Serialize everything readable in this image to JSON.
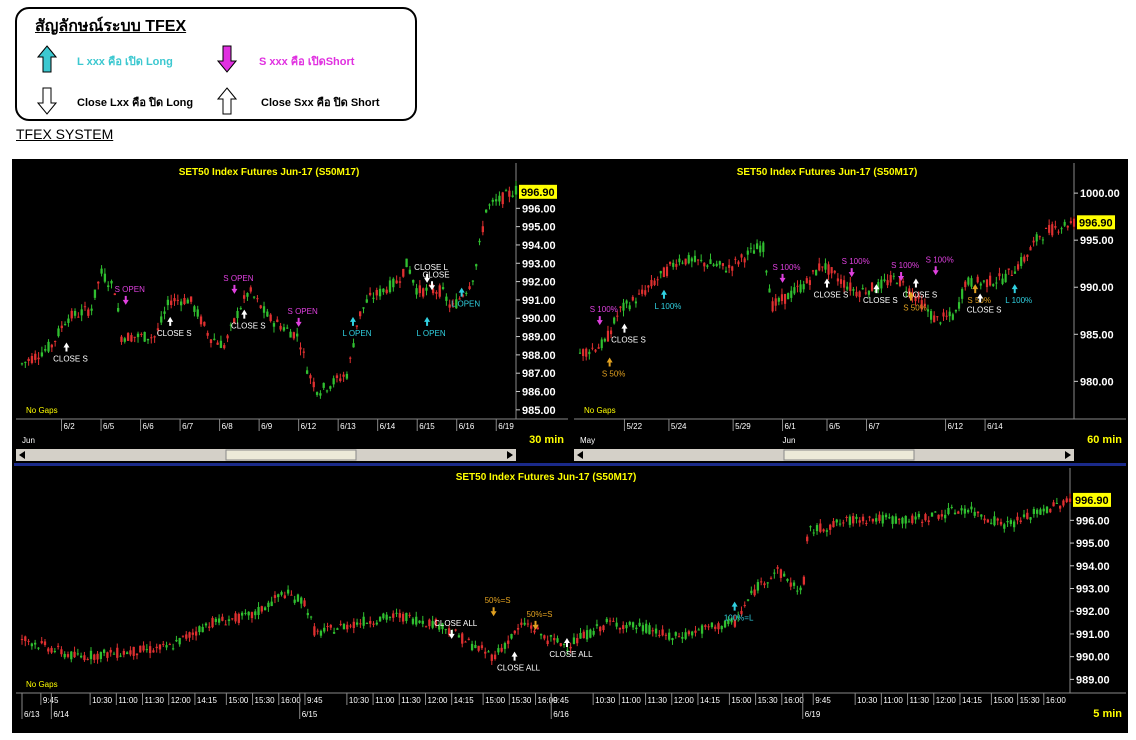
{
  "legend": {
    "title": "สัญลักษณ์ระบบ TFEX",
    "items": [
      {
        "label": "L xxx คือ เปิด Long",
        "color": "#3cc8d0",
        "icon": "arrow-up-cyan-icon"
      },
      {
        "label": "S xxx คือ เปิดShort",
        "color": "#e030e0",
        "icon": "arrow-down-magenta-icon"
      },
      {
        "label": "Close Lxx คือ ปิด Long",
        "color": "#000000",
        "icon": "arrow-down-outline-icon"
      },
      {
        "label": "Close Sxx คือ ปิด Short",
        "color": "#000000",
        "icon": "arrow-up-outline-icon"
      }
    ]
  },
  "section_title": "TFEX SYSTEM",
  "colors": {
    "up": "#30c030",
    "down": "#e03030",
    "title": "#ffff00",
    "long": "#30d0e0",
    "short": "#e040e0",
    "half": "#e0a020",
    "close": "#ffffff",
    "bg": "#000000",
    "axis_text": "#ffffff",
    "price_tag": "#ffff00"
  },
  "chart_data": [
    {
      "type": "candlestick",
      "title": "SET50 Index Futures Jun-17 (S50M17)",
      "interval_label": "30 min",
      "gap_label": "No Gaps",
      "period_label": "Jun",
      "last_price": "996.90",
      "ylim": [
        984.5,
        997.6
      ],
      "yticks": [
        "996.00",
        "995.00",
        "994.00",
        "993.00",
        "992.00",
        "991.00",
        "990.00",
        "989.00",
        "988.00",
        "987.00",
        "986.00",
        "985.00"
      ],
      "ytick_values": [
        996,
        995,
        994,
        993,
        992,
        991,
        990,
        989,
        988,
        987,
        986,
        985
      ],
      "xticks": [
        "6/2",
        "6/5",
        "6/6",
        "6/7",
        "6/8",
        "6/9",
        "6/12",
        "6/13",
        "6/14",
        "6/15",
        "6/16",
        "6/19"
      ],
      "xtick_pos": [
        0.08,
        0.16,
        0.24,
        0.32,
        0.4,
        0.48,
        0.56,
        0.64,
        0.72,
        0.8,
        0.88,
        0.96
      ],
      "anchors": [
        [
          0,
          987.5
        ],
        [
          0.06,
          988.5
        ],
        [
          0.09,
          990
        ],
        [
          0.14,
          990.5
        ],
        [
          0.16,
          992.5
        ],
        [
          0.19,
          991.5
        ],
        [
          0.2,
          989
        ],
        [
          0.27,
          989
        ],
        [
          0.3,
          991
        ],
        [
          0.34,
          991
        ],
        [
          0.38,
          989
        ],
        [
          0.41,
          988.5
        ],
        [
          0.44,
          990.5
        ],
        [
          0.46,
          991.5
        ],
        [
          0.5,
          990
        ],
        [
          0.56,
          989
        ],
        [
          0.58,
          987
        ],
        [
          0.6,
          986
        ],
        [
          0.66,
          987
        ],
        [
          0.68,
          990
        ],
        [
          0.7,
          991
        ],
        [
          0.76,
          992
        ],
        [
          0.78,
          993
        ],
        [
          0.8,
          991.5
        ],
        [
          0.85,
          991.5
        ],
        [
          0.87,
          990.5
        ],
        [
          0.91,
          992
        ],
        [
          0.92,
          993
        ],
        [
          0.94,
          996
        ],
        [
          1.0,
          997
        ]
      ],
      "annotations": [
        {
          "text": "CLOSE S",
          "x": 0.09,
          "y": 988.4,
          "arrow": "up",
          "color": "close"
        },
        {
          "text": "S OPEN",
          "x": 0.21,
          "y": 991.0,
          "arrow": "down",
          "color": "short"
        },
        {
          "text": "CLOSE S",
          "x": 0.3,
          "y": 989.8,
          "arrow": "up",
          "color": "close"
        },
        {
          "text": "S OPEN",
          "x": 0.43,
          "y": 991.6,
          "arrow": "down",
          "color": "short"
        },
        {
          "text": "CLOSE S",
          "x": 0.45,
          "y": 990.2,
          "arrow": "up",
          "color": "close"
        },
        {
          "text": "S OPEN",
          "x": 0.56,
          "y": 989.8,
          "arrow": "down",
          "color": "short"
        },
        {
          "text": "L OPEN",
          "x": 0.67,
          "y": 989.8,
          "arrow": "up",
          "color": "long"
        },
        {
          "text": "CLOSE L",
          "x": 0.82,
          "y": 992.2,
          "arrow": "down",
          "color": "close"
        },
        {
          "text": "CLOSE",
          "x": 0.83,
          "y": 991.8,
          "arrow": "down",
          "color": "close"
        },
        {
          "text": "L OPEN",
          "x": 0.89,
          "y": 991.4,
          "arrow": "up",
          "color": "long"
        },
        {
          "text": "L OPEN",
          "x": 0.82,
          "y": 989.8,
          "arrow": "up",
          "color": "long"
        }
      ]
    },
    {
      "type": "candlestick",
      "title": "SET50 Index Futures Jun-17 (S50M17)",
      "interval_label": "60 min",
      "gap_label": "No Gaps",
      "period_label": "May",
      "period_label2": "Jun",
      "last_price": "996.90",
      "ylim": [
        976,
        1001.5
      ],
      "yticks": [
        "1000.00",
        "995.00",
        "990.00",
        "985.00",
        "980.00"
      ],
      "ytick_values": [
        1000,
        995,
        990,
        985,
        980
      ],
      "xticks": [
        "5/22",
        "5/24",
        "5/29",
        "6/1",
        "6/5",
        "6/7",
        "6/12",
        "6/14"
      ],
      "xtick_pos": [
        0.09,
        0.18,
        0.31,
        0.41,
        0.5,
        0.58,
        0.74,
        0.82
      ],
      "anchors": [
        [
          0,
          983
        ],
        [
          0.05,
          984
        ],
        [
          0.08,
          987.5
        ],
        [
          0.12,
          989
        ],
        [
          0.16,
          991
        ],
        [
          0.2,
          993
        ],
        [
          0.26,
          992.5
        ],
        [
          0.3,
          992
        ],
        [
          0.34,
          993.5
        ],
        [
          0.37,
          994.5
        ],
        [
          0.39,
          988
        ],
        [
          0.42,
          989
        ],
        [
          0.46,
          990.5
        ],
        [
          0.49,
          992.5
        ],
        [
          0.52,
          991
        ],
        [
          0.56,
          989.5
        ],
        [
          0.6,
          990
        ],
        [
          0.64,
          991
        ],
        [
          0.68,
          989
        ],
        [
          0.72,
          986.5
        ],
        [
          0.76,
          987
        ],
        [
          0.78,
          990.5
        ],
        [
          0.82,
          990.5
        ],
        [
          0.86,
          991
        ],
        [
          0.9,
          993
        ],
        [
          0.93,
          995.5
        ],
        [
          0.97,
          996.5
        ],
        [
          1.0,
          996.9
        ]
      ],
      "annotations": [
        {
          "text": "S 100%",
          "x": 0.04,
          "y": 986.5,
          "arrow": "down",
          "color": "short"
        },
        {
          "text": "CLOSE S",
          "x": 0.09,
          "y": 985.6,
          "arrow": "up",
          "color": "close"
        },
        {
          "text": "S 50%",
          "x": 0.06,
          "y": 982.0,
          "arrow": "up",
          "color": "half"
        },
        {
          "text": "L 100%",
          "x": 0.17,
          "y": 989.2,
          "arrow": "up",
          "color": "long"
        },
        {
          "text": "S 100%",
          "x": 0.41,
          "y": 991.0,
          "arrow": "down",
          "color": "short"
        },
        {
          "text": "CLOSE S",
          "x": 0.5,
          "y": 990.4,
          "arrow": "up",
          "color": "close"
        },
        {
          "text": "S 100%",
          "x": 0.55,
          "y": 991.6,
          "arrow": "down",
          "color": "short"
        },
        {
          "text": "CLOSE S",
          "x": 0.6,
          "y": 989.8,
          "arrow": "up",
          "color": "close"
        },
        {
          "text": "S 100%",
          "x": 0.65,
          "y": 991.2,
          "arrow": "down",
          "color": "short"
        },
        {
          "text": "CLOSE S",
          "x": 0.68,
          "y": 990.4,
          "arrow": "up",
          "color": "close"
        },
        {
          "text": "S 50%",
          "x": 0.67,
          "y": 989.0,
          "arrow": "up",
          "color": "half"
        },
        {
          "text": "S 100%",
          "x": 0.72,
          "y": 991.8,
          "arrow": "down",
          "color": "short"
        },
        {
          "text": "S 50%",
          "x": 0.8,
          "y": 989.8,
          "arrow": "up",
          "color": "half"
        },
        {
          "text": "CLOSE S",
          "x": 0.81,
          "y": 988.8,
          "arrow": "up",
          "color": "close"
        },
        {
          "text": "L 100%",
          "x": 0.88,
          "y": 989.8,
          "arrow": "up",
          "color": "long"
        }
      ]
    },
    {
      "type": "candlestick",
      "title": "SET50 Index Futures Jun-17 (S50M17)",
      "interval_label": "5 min",
      "gap_label": "No Gaps",
      "last_price": "996.90",
      "ylim": [
        988.4,
        997.6
      ],
      "yticks": [
        "996.00",
        "995.00",
        "994.00",
        "993.00",
        "992.00",
        "991.00",
        "990.00",
        "989.00"
      ],
      "ytick_values": [
        996,
        995,
        994,
        993,
        992,
        991,
        990,
        989
      ],
      "xticks": [
        "9:45",
        "10:30",
        "11:00",
        "11:30",
        "12:00",
        "14:15",
        "15:00",
        "15:30",
        "16:00",
        "9:45",
        "10:30",
        "11:00",
        "11:30",
        "12:00",
        "14:15",
        "15:00",
        "15:30",
        "16:00",
        "9:45",
        "10:30",
        "11:00",
        "11:30",
        "12:00",
        "14:15",
        "15:00",
        "15:30",
        "16:00",
        "9:45",
        "10:30",
        "11:00",
        "11:30",
        "12:00",
        "14:15",
        "15:00",
        "15:30",
        "16:00"
      ],
      "xtick_pos": [
        0.018,
        0.065,
        0.09,
        0.115,
        0.14,
        0.165,
        0.195,
        0.22,
        0.245,
        0.27,
        0.31,
        0.335,
        0.36,
        0.385,
        0.41,
        0.44,
        0.465,
        0.49,
        0.505,
        0.545,
        0.57,
        0.595,
        0.62,
        0.645,
        0.675,
        0.7,
        0.725,
        0.755,
        0.795,
        0.82,
        0.845,
        0.87,
        0.895,
        0.925,
        0.95,
        0.975
      ],
      "date_labels": [
        "6/13",
        "6/14",
        "6/15",
        "6/16",
        "6/19"
      ],
      "date_pos": [
        0.0,
        0.028,
        0.265,
        0.505,
        0.745
      ],
      "anchors": [
        [
          0,
          990.8
        ],
        [
          0.05,
          990
        ],
        [
          0.1,
          990.2
        ],
        [
          0.14,
          990.4
        ],
        [
          0.18,
          991.5
        ],
        [
          0.22,
          991.8
        ],
        [
          0.25,
          992.8
        ],
        [
          0.27,
          992.4
        ],
        [
          0.28,
          991
        ],
        [
          0.32,
          991.5
        ],
        [
          0.36,
          991.8
        ],
        [
          0.4,
          991.4
        ],
        [
          0.43,
          990.5
        ],
        [
          0.45,
          990
        ],
        [
          0.48,
          991.5
        ],
        [
          0.5,
          990.8
        ],
        [
          0.52,
          990.5
        ],
        [
          0.56,
          991.5
        ],
        [
          0.6,
          991.2
        ],
        [
          0.62,
          990.8
        ],
        [
          0.65,
          991.2
        ],
        [
          0.68,
          991.5
        ],
        [
          0.7,
          993
        ],
        [
          0.72,
          993.8
        ],
        [
          0.74,
          993
        ],
        [
          0.745,
          992.8
        ],
        [
          0.75,
          995.5
        ],
        [
          0.8,
          996.1
        ],
        [
          0.85,
          996
        ],
        [
          0.9,
          996.5
        ],
        [
          0.94,
          995.8
        ],
        [
          1.0,
          996.9
        ]
      ],
      "annotations": [
        {
          "text": "CLOSE ALL",
          "x": 0.41,
          "y": 991.0,
          "arrow": "down",
          "color": "close"
        },
        {
          "text": "50%=S",
          "x": 0.45,
          "y": 992.0,
          "arrow": "down",
          "color": "half"
        },
        {
          "text": "50%=S",
          "x": 0.49,
          "y": 991.4,
          "arrow": "down",
          "color": "half"
        },
        {
          "text": "CLOSE ALL",
          "x": 0.47,
          "y": 990.0,
          "arrow": "up",
          "color": "close"
        },
        {
          "text": "CLOSE ALL",
          "x": 0.52,
          "y": 990.6,
          "arrow": "up",
          "color": "close"
        },
        {
          "text": "100%=L",
          "x": 0.68,
          "y": 992.2,
          "arrow": "up",
          "color": "long"
        }
      ]
    }
  ]
}
